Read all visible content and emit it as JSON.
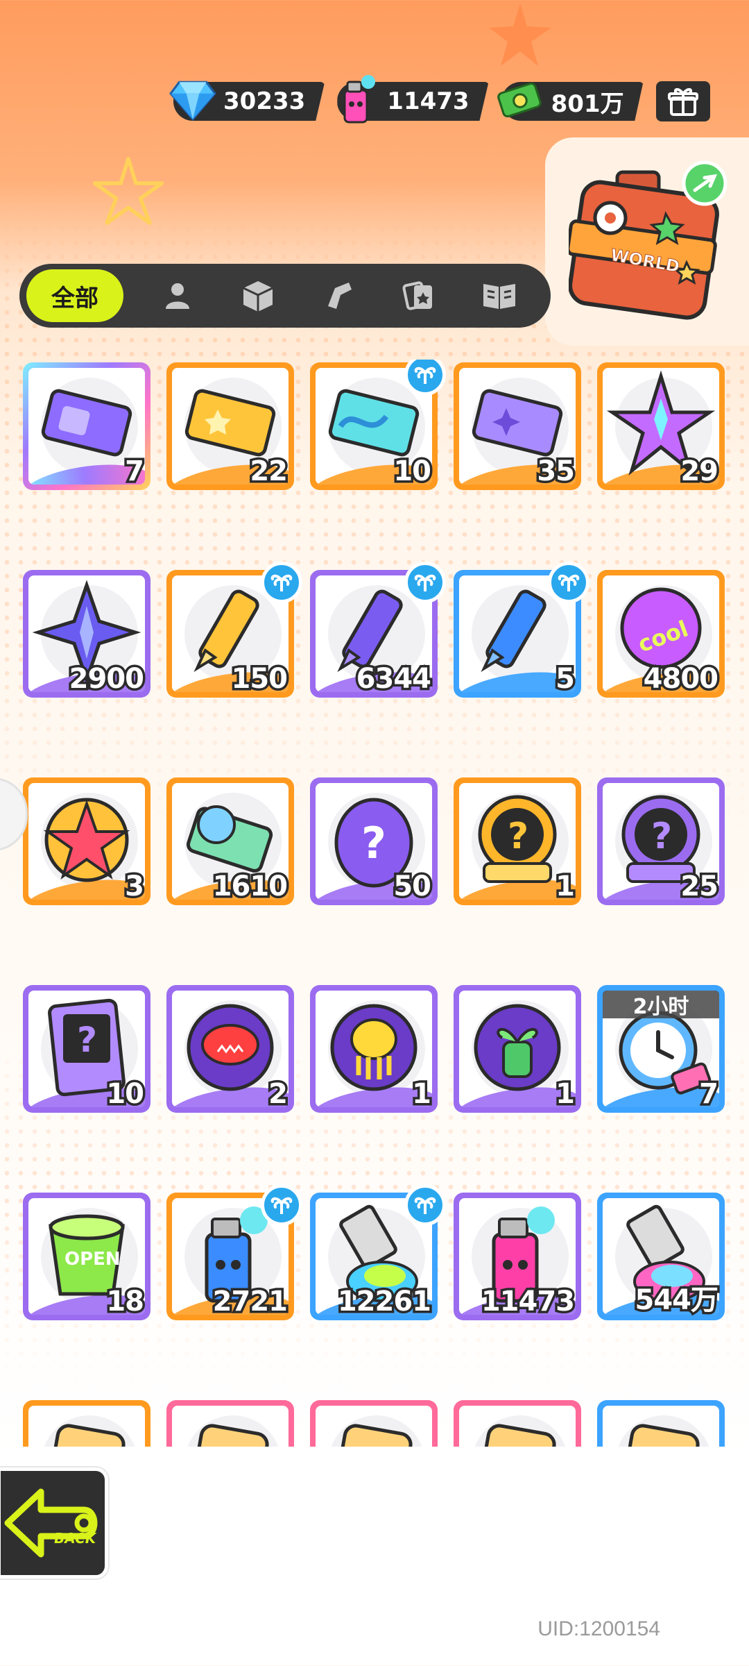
{
  "currencies": [
    {
      "icon": "diamond-icon",
      "value": "30233"
    },
    {
      "icon": "spray-can-icon",
      "value": "11473"
    },
    {
      "icon": "cash-icon",
      "value": "801万"
    }
  ],
  "shop_icon": "gift-box-icon",
  "suitcase": {
    "icon": "world-suitcase-icon",
    "label": "WORLD"
  },
  "tabs": [
    {
      "label": "全部",
      "active": true
    },
    {
      "icon": "person-icon"
    },
    {
      "icon": "box-icon"
    },
    {
      "icon": "spray-gun-icon"
    },
    {
      "icon": "cards-icon"
    },
    {
      "icon": "book-icon"
    }
  ],
  "items": [
    {
      "name": "purple-ticket",
      "count": "7",
      "rarity": "rainbow"
    },
    {
      "name": "gold-ticket",
      "count": "22",
      "rarity": "orange"
    },
    {
      "name": "wave-ticket",
      "count": "10",
      "rarity": "orange",
      "badge": true
    },
    {
      "name": "violet-ticket",
      "count": "35",
      "rarity": "orange"
    },
    {
      "name": "rainbow-star",
      "count": "29",
      "rarity": "orange"
    },
    {
      "name": "purple-star",
      "count": "2900",
      "rarity": "purple"
    },
    {
      "name": "yellow-crayon",
      "count": "150",
      "rarity": "orange",
      "badge": true
    },
    {
      "name": "purple-crayon",
      "count": "6344",
      "rarity": "purple",
      "badge": true
    },
    {
      "name": "blue-crayon",
      "count": "5",
      "rarity": "blue",
      "badge": true
    },
    {
      "name": "cool-sticker",
      "count": "4800",
      "rarity": "orange"
    },
    {
      "name": "star-badge",
      "count": "3",
      "rarity": "orange"
    },
    {
      "name": "season-ticket",
      "count": "1610",
      "rarity": "orange"
    },
    {
      "name": "mystery-egg",
      "count": "50",
      "rarity": "purple"
    },
    {
      "name": "deity-mystery-gold",
      "count": "1",
      "rarity": "orange"
    },
    {
      "name": "deity-mystery-purple",
      "count": "25",
      "rarity": "purple"
    },
    {
      "name": "travel-card",
      "count": "10",
      "rarity": "purple"
    },
    {
      "name": "piranha-orb",
      "count": "2",
      "rarity": "purple"
    },
    {
      "name": "jelly-orb",
      "count": "1",
      "rarity": "purple"
    },
    {
      "name": "plant-orb",
      "count": "1",
      "rarity": "purple"
    },
    {
      "name": "alarm-clock",
      "count": "7",
      "rarity": "blue",
      "timer": "2小时"
    },
    {
      "name": "open-cup",
      "count": "18",
      "rarity": "purple"
    },
    {
      "name": "blue-spray",
      "count": "2721",
      "rarity": "orange",
      "badge": true
    },
    {
      "name": "paint-tube-green",
      "count": "12261",
      "rarity": "blue",
      "badge": true
    },
    {
      "name": "pink-spray",
      "count": "11473",
      "rarity": "purple"
    },
    {
      "name": "paint-tube-rainbow",
      "count": "544万",
      "rarity": "blue"
    },
    {
      "name": "item-26",
      "count": "",
      "rarity": "orange"
    },
    {
      "name": "item-27",
      "count": "",
      "rarity": "pink"
    },
    {
      "name": "item-28",
      "count": "",
      "rarity": "pink"
    },
    {
      "name": "item-29",
      "count": "",
      "rarity": "pink"
    },
    {
      "name": "item-30",
      "count": "",
      "rarity": "blue"
    }
  ],
  "back": {
    "label": "BACK"
  },
  "uid": "UID:1200154",
  "colors": {
    "accent": "#d9f21a",
    "purple": "#9b6cf0",
    "orange": "#ff9a1f",
    "blue": "#3ca3ff",
    "pink": "#ff6a9a",
    "dark": "#2e2e2e"
  }
}
